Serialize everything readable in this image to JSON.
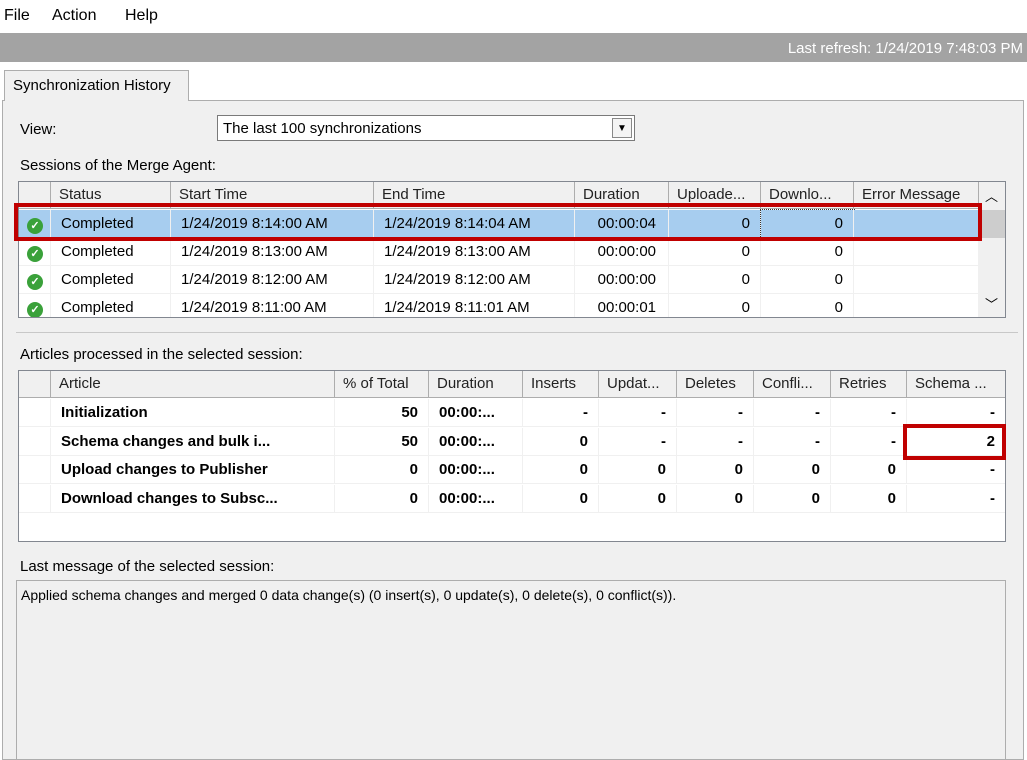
{
  "menu": [
    "File",
    "Action",
    "Help"
  ],
  "refresh": "Last refresh: 1/24/2019 7:48:03 PM",
  "tab": "Synchronization History",
  "view": {
    "label": "View:",
    "value": "The last 100 synchronizations"
  },
  "sessions": {
    "label": "Sessions of the Merge Agent:",
    "columns": [
      "",
      "Status",
      "Start Time",
      "End Time",
      "Duration",
      "Uploade...",
      "Downlo...",
      "Error Message"
    ],
    "rows": [
      {
        "icon": "check-icon",
        "status": "Completed",
        "start": "1/24/2019 8:14:00 AM",
        "end": "1/24/2019 8:14:04 AM",
        "duration": "00:00:04",
        "uploaded": "0",
        "downloaded": "0",
        "error": "",
        "selected": true
      },
      {
        "icon": "check-icon",
        "status": "Completed",
        "start": "1/24/2019 8:13:00 AM",
        "end": "1/24/2019 8:13:00 AM",
        "duration": "00:00:00",
        "uploaded": "0",
        "downloaded": "0",
        "error": ""
      },
      {
        "icon": "check-icon",
        "status": "Completed",
        "start": "1/24/2019 8:12:00 AM",
        "end": "1/24/2019 8:12:00 AM",
        "duration": "00:00:00",
        "uploaded": "0",
        "downloaded": "0",
        "error": ""
      },
      {
        "icon": "check-icon",
        "status": "Completed",
        "start": "1/24/2019 8:11:00 AM",
        "end": "1/24/2019 8:11:01 AM",
        "duration": "00:00:01",
        "uploaded": "0",
        "downloaded": "0",
        "error": ""
      }
    ]
  },
  "articles": {
    "label": "Articles processed in the selected session:",
    "columns": [
      "",
      "Article",
      "% of Total",
      "Duration",
      "Inserts",
      "Updat...",
      "Deletes",
      "Confli...",
      "Retries",
      "Schema ..."
    ],
    "rows": [
      [
        "Initialization",
        "50",
        "00:00:...",
        "-",
        "-",
        "-",
        "-",
        "-",
        "-"
      ],
      [
        "Schema changes and bulk i...",
        "50",
        "00:00:...",
        "0",
        "-",
        "-",
        "-",
        "-",
        "2"
      ],
      [
        "Upload changes to Publisher",
        "0",
        "00:00:...",
        "0",
        "0",
        "0",
        "0",
        "0",
        "-"
      ],
      [
        "Download changes to Subsc...",
        "0",
        "00:00:...",
        "0",
        "0",
        "0",
        "0",
        "0",
        "-"
      ]
    ]
  },
  "last_message": {
    "label": "Last message of the selected session:",
    "text": "Applied schema changes and merged 0 data change(s) (0 insert(s), 0 update(s), 0 delete(s), 0 conflict(s))."
  },
  "colors": {
    "highlight": "#c00000",
    "selection": "#a7cdef"
  }
}
